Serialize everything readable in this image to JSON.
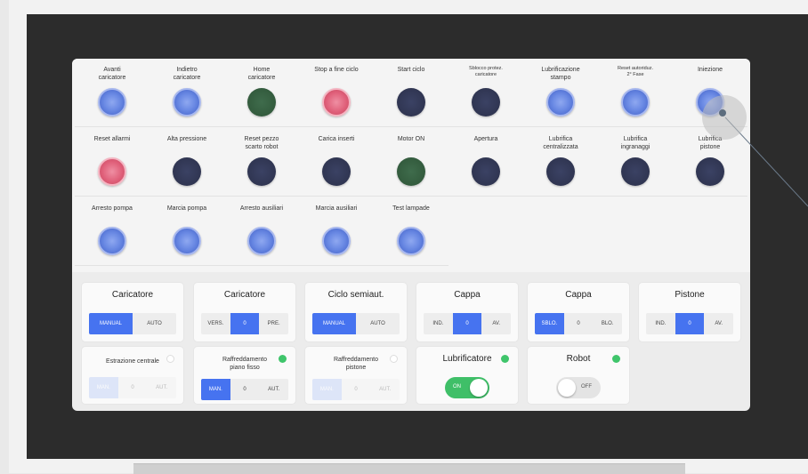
{
  "buttons": [
    {
      "label": "Avanti\ncaricatore",
      "lamp": "blue"
    },
    {
      "label": "Indietro\ncaricatore",
      "lamp": "blue"
    },
    {
      "label": "Home\ncaricatore",
      "lamp": "green"
    },
    {
      "label": "Stop a fine ciclo",
      "lamp": "red"
    },
    {
      "label": "Start ciclo",
      "lamp": "dark"
    },
    {
      "label": "Sblocco protez.\ncaricatore",
      "lamp": "dark",
      "small": true
    },
    {
      "label": "Lubrificazione\nstampo",
      "lamp": "blue"
    },
    {
      "label": "Reset autoriduz.\n2° Fase",
      "lamp": "blue",
      "small": true
    },
    {
      "label": "Iniezione",
      "lamp": "blue"
    },
    {
      "label": "Reset allarmi",
      "lamp": "red"
    },
    {
      "label": "Alta pressione",
      "lamp": "dark"
    },
    {
      "label": "Reset pezzo\nscarto robot",
      "lamp": "dark"
    },
    {
      "label": "Carica inserti",
      "lamp": "dark"
    },
    {
      "label": "Motor ON",
      "lamp": "green"
    },
    {
      "label": "Apertura",
      "lamp": "dark"
    },
    {
      "label": "Lubrifica\ncentralizzata",
      "lamp": "dark"
    },
    {
      "label": "Lubrifica\ningranaggi",
      "lamp": "dark"
    },
    {
      "label": "Lubrifica\npistone",
      "lamp": "dark"
    },
    {
      "label": "Arresto pompa",
      "lamp": "blue"
    },
    {
      "label": "Marcia pompa",
      "lamp": "blue"
    },
    {
      "label": "Arresto ausiliari",
      "lamp": "blue"
    },
    {
      "label": "Marcia ausiliari",
      "lamp": "blue"
    },
    {
      "label": "Test lampade",
      "lamp": "blue"
    }
  ],
  "modes": {
    "caricatore1": {
      "title": "Caricatore",
      "options": [
        "MANUAL",
        "AUTO"
      ],
      "active": 0
    },
    "caricatore2": {
      "title": "Caricatore",
      "options": [
        "VERS.",
        "0",
        "PRE."
      ],
      "active": 1
    },
    "ciclo": {
      "title": "Ciclo semiaut.",
      "options": [
        "MANUAL",
        "AUTO"
      ],
      "active": 0
    },
    "cappa1": {
      "title": "Cappa",
      "options": [
        "IND.",
        "0",
        "AV."
      ],
      "active": 1
    },
    "cappa2": {
      "title": "Cappa",
      "options": [
        "SBLO.",
        "0",
        "BLO."
      ],
      "active": 0
    },
    "pistone": {
      "title": "Pistone",
      "options": [
        "IND.",
        "0",
        "AV."
      ],
      "active": 1
    },
    "estrazione": {
      "title": "Estrazione centrale",
      "options": [
        "MAN.",
        "0",
        "AUT."
      ],
      "active": 0,
      "enabled": false
    },
    "raffr_piano": {
      "title": "Raffreddamento\npiano fisso",
      "options": [
        "MAN.",
        "0",
        "AUT."
      ],
      "active": 0,
      "enabled": true
    },
    "raffr_pistone": {
      "title": "Raffreddamento\npistone",
      "options": [
        "MAN.",
        "0",
        "AUT."
      ],
      "active": 0,
      "enabled": false
    }
  },
  "toggles": {
    "lubrificatore": {
      "title": "Lubrificatore",
      "state": "ON",
      "on": true
    },
    "robot": {
      "title": "Robot",
      "state": "OFF",
      "on": false
    }
  },
  "colors": {
    "accent": "#4673f0",
    "status_on": "#3fc56b",
    "lamp_red": "#e0607a",
    "lamp_blue": "#6b8ae4",
    "lamp_green": "#2e5437",
    "lamp_dark": "#2b304a"
  }
}
